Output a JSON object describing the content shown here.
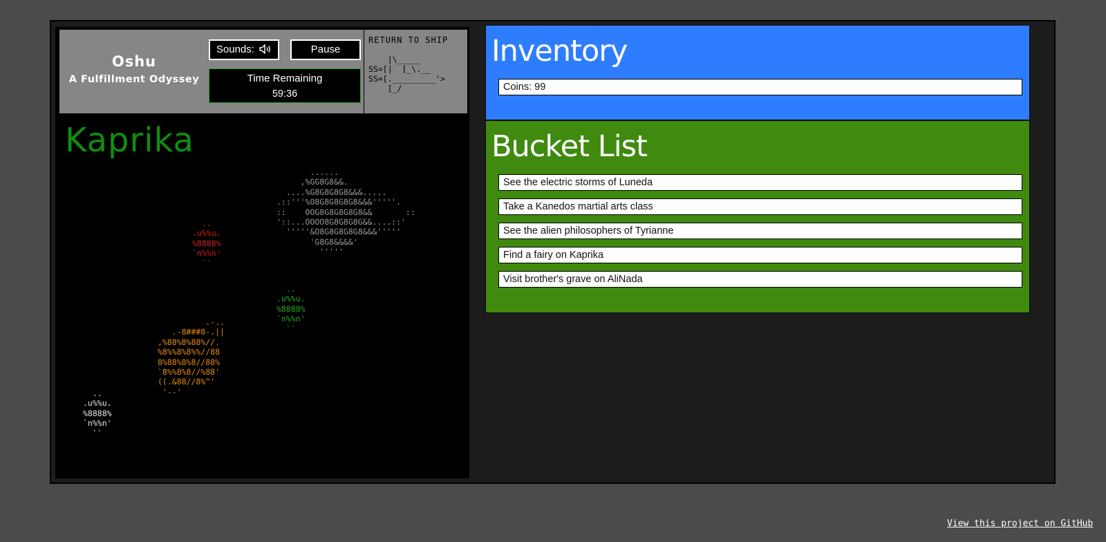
{
  "hud": {
    "title": "Oshu",
    "subtitle": "A Fulfillment Odyssey",
    "sounds_label": "Sounds:",
    "sound_icon": "speaker-volume-icon",
    "pause_label": "Pause",
    "time_label": "Time Remaining",
    "time_value": "59:36",
    "return_label": "RETURN TO SHIP",
    "ship_art": "    |\\_____\nSS=[|  [_\\.__\nSS=[._________'>\n    [_/"
  },
  "planet": {
    "name": "Kaprika",
    "name_color": "#0f8f0f"
  },
  "map_objects": {
    "big_planet": "       ......\n     ,%GG8G8&&.\n  ....%G8G8G8G8&&&.....\n.::'''%O8G8G8G8G8&&&'''''.\n::    OOG8G8G8G8G8&&       ::\n'::...OOOO8G8G8G8G&&....::'\n  '''''&O8G8G8G8G8&&&'''''\n       'G8G8&&&&'\n         '''''",
    "red_planet": "  ..\n.u%%u.\n%8888%\n`n%%n'\n  ``",
    "green_planet": "  ..\n.u%%u.\n%8888%\n`n%%n'\n  ``",
    "orange_planet": "          .-..\n   .-8###8-.||\n,%88%8%88%//.\n%8%%8%8%%//88\n8%88%8%8//88%\n`8%%8%8//%88'\n((.&88//8%^'\n '--'",
    "white_planet": "  ..\n.u%%u.\n%8888%\n`n%%n'\n  ``"
  },
  "inventory": {
    "title": "Inventory",
    "coins": "Coins: 99"
  },
  "bucket_list": {
    "title": "Bucket List",
    "items": [
      "See the electric storms of Luneda",
      "Take a Kanedos martial arts class",
      "See the alien philosophers of Tyrianne",
      "Find a fairy on Kaprika",
      "Visit brother's grave on AliNada"
    ]
  },
  "footer": {
    "github_link": "View this project on GitHub"
  },
  "colors": {
    "inventory_bg": "#2f7dff",
    "bucket_bg": "#3f8a0f",
    "hud_bg": "#868686",
    "page_bg": "#4b4b4b"
  }
}
